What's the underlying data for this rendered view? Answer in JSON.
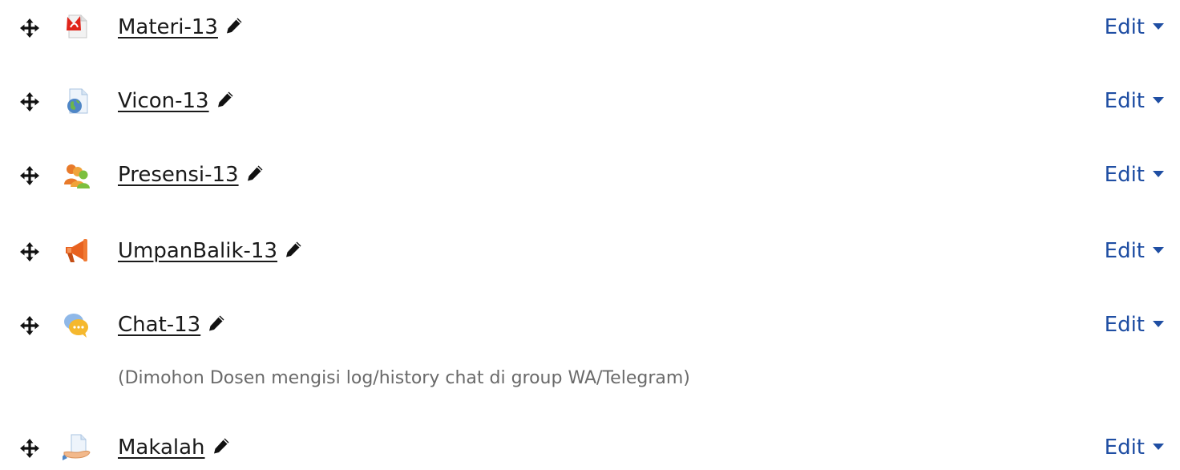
{
  "activities": [
    {
      "name": "Materi-13",
      "type_icon": "pdf-icon",
      "edit_label": "Edit"
    },
    {
      "name": "Vicon-13",
      "type_icon": "url-globe-icon",
      "edit_label": "Edit"
    },
    {
      "name": "Presensi-13",
      "type_icon": "attendance-people-icon",
      "edit_label": "Edit"
    },
    {
      "name": "UmpanBalik-13",
      "type_icon": "feedback-megaphone-icon",
      "edit_label": "Edit"
    },
    {
      "name": "Chat-13",
      "type_icon": "chat-bubble-icon",
      "edit_label": "Edit",
      "description": "(Dimohon Dosen mengisi log/history chat di group WA/Telegram)"
    },
    {
      "name": "Makalah",
      "type_icon": "assignment-hand-icon",
      "edit_label": "Edit"
    }
  ],
  "colors": {
    "link": "#1a1a1a",
    "edit": "#1f4ea3",
    "description": "#6a6a6a"
  }
}
